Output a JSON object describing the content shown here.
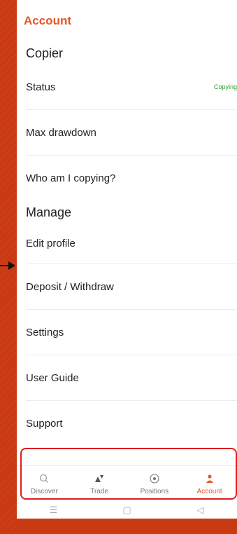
{
  "header": {
    "title": "Account"
  },
  "copier": {
    "heading": "Copier",
    "status_label": "Status",
    "status_value": "Copying",
    "max_drawdown_label": "Max drawdown",
    "who_copying_label": "Who am I copying?"
  },
  "manage": {
    "heading": "Manage",
    "items": [
      "Edit profile",
      "Deposit / Withdraw",
      "Settings",
      "User Guide",
      "Support"
    ]
  },
  "nav": {
    "items": [
      {
        "label": "Discover",
        "icon": "search-icon"
      },
      {
        "label": "Trade",
        "icon": "trade-icon"
      },
      {
        "label": "Positions",
        "icon": "positions-icon"
      },
      {
        "label": "Account",
        "icon": "account-icon",
        "active": true
      }
    ]
  },
  "system_bar": {
    "menu": "☰",
    "home": "▢",
    "back": "◁"
  },
  "colors": {
    "accent": "#e8562a",
    "status": "#2a9d2a",
    "highlight": "#e01d1d"
  }
}
